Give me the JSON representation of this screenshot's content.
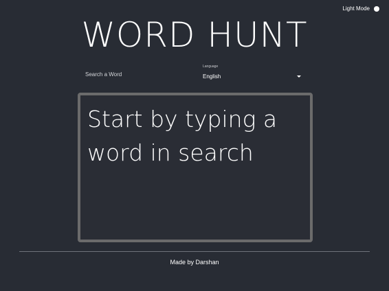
{
  "header": {
    "mode_label": "Light Mode",
    "title": "WORD HUNT"
  },
  "search": {
    "placeholder": "Search a Word",
    "value": ""
  },
  "language": {
    "label": "Language",
    "selected": "English"
  },
  "panel": {
    "message": "Start by typing a word in search"
  },
  "footer": {
    "credit": "Made by Darshan"
  },
  "colors": {
    "background": "#282c34",
    "panel_border": "#6b6b6b",
    "text": "#ffffff"
  },
  "icons": {
    "mode_toggle": "toggle-knob-icon",
    "language_dropdown": "caret-down-icon"
  }
}
